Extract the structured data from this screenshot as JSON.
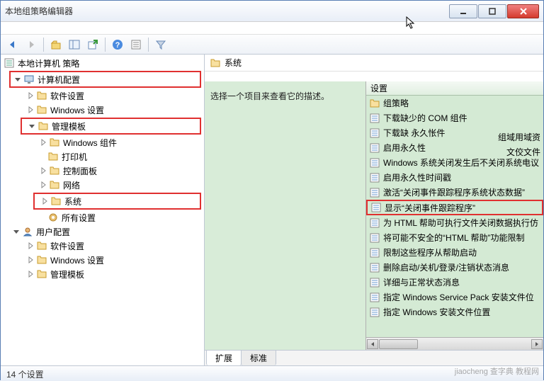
{
  "window": {
    "title": "本地组策略编辑器"
  },
  "tree": {
    "root": "本地计算机 策略",
    "computer_config": "计算机配置",
    "software_settings": "软件设置",
    "windows_settings": "Windows 设置",
    "admin_templates": "管理模板",
    "windows_components": "Windows 组件",
    "printers": "打印机",
    "control_panel": "控制面板",
    "network": "网络",
    "system": "系统",
    "all_settings": "所有设置",
    "user_config": "用户配置",
    "u_software_settings": "软件设置",
    "u_windows_settings": "Windows 设置",
    "u_admin_templates": "管理模板"
  },
  "content": {
    "header": "系统",
    "description": "选择一个项目来查看它的描述。",
    "list_header": "设置",
    "extra1": "组域用域资",
    "extra2": "文佼文件",
    "items": [
      {
        "type": "folder",
        "label": "组策略"
      },
      {
        "type": "setting",
        "label": "下载缺少的 COM 组件"
      },
      {
        "type": "setting",
        "label": "下载缺 永久怅件"
      },
      {
        "type": "setting",
        "label": "启用永久性"
      },
      {
        "type": "setting",
        "label": "Windows 系统关闭发生后不关闭系统电议"
      },
      {
        "type": "setting",
        "label": "启用永久性时间戳"
      },
      {
        "type": "setting",
        "label": "激活“关闭事件跟踪程序系统状态数据”"
      },
      {
        "type": "setting",
        "label": "显示“关闭事件跟踪程序”",
        "highlight": true
      },
      {
        "type": "setting",
        "label": "为 HTML 帮助可执行文件关闭数据执行仿"
      },
      {
        "type": "setting",
        "label": "将可能不安全的“HTML 帮助”功能限制"
      },
      {
        "type": "setting",
        "label": "限制这些程序从帮助启动"
      },
      {
        "type": "setting",
        "label": "删除启动/关机/登录/注销状态消息"
      },
      {
        "type": "setting",
        "label": "详细与正常状态消息"
      },
      {
        "type": "setting",
        "label": "指定 Windows Service Pack 安装文件位"
      },
      {
        "type": "setting",
        "label": "指定 Windows 安装文件位置"
      }
    ]
  },
  "tabs": {
    "extended": "扩展",
    "standard": "标准"
  },
  "status": "14 个设置",
  "watermark": "jiaocheng 查字典 教程网"
}
